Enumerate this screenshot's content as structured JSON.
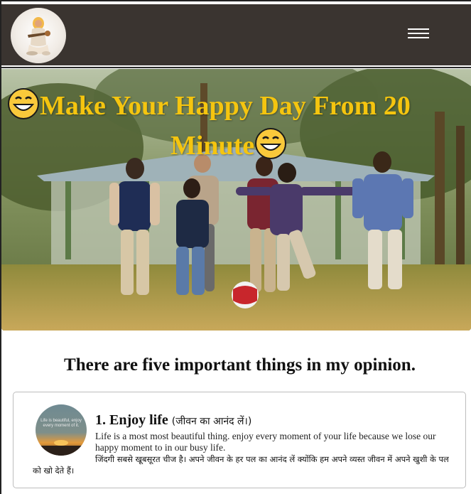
{
  "header": {
    "logo_name": "saraswati-logo",
    "menu_icon": "hamburger-icon"
  },
  "hero": {
    "title_line1": "Make Your Happy Day From 20",
    "title_line2": "Minute",
    "emoji": "grinning-face-icon"
  },
  "section": {
    "title": "There are five important things in my opinion."
  },
  "cards": [
    {
      "heading_en": "1. Enjoy life",
      "heading_hi": "(जीवन का आनंद लें।)",
      "body_en": "Life is a most most beautiful thing. enjoy every moment of your life because we lose our happy moment to in our busy life.",
      "body_hi": "जिंदगी सबसे खूबसूरत चीज है। अपने जीवन के हर पल का आनंद लें क्योंकि हम अपने व्यस्त जीवन में अपने खुशी के पल को खो देते हैं।",
      "thumb_caption": "Life is beautiful, enjoy every moment of it."
    }
  ],
  "colors": {
    "navbar": "#3a3430",
    "title": "#f5c50f"
  }
}
